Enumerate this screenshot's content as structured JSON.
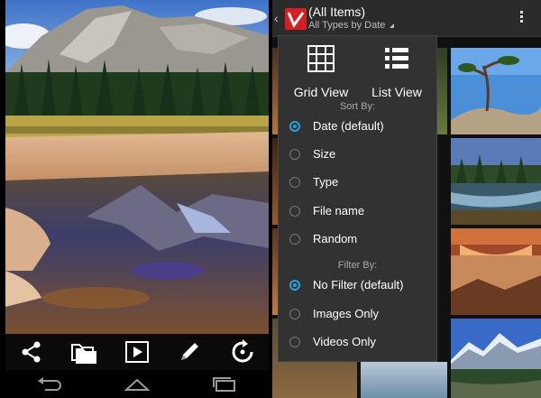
{
  "left_phone": {
    "toolbar": [
      {
        "icon": "share-icon"
      },
      {
        "icon": "folder-move-icon"
      },
      {
        "icon": "slideshow-play-icon"
      },
      {
        "icon": "edit-pencil-icon"
      },
      {
        "icon": "rotate-icon"
      }
    ],
    "nav": [
      "back-icon",
      "home-icon",
      "recents-icon"
    ]
  },
  "right_phone": {
    "header": {
      "title": "(All Items)",
      "subtitle": "All Types by Date",
      "logo_color": "#d81e23"
    },
    "menu": {
      "views": [
        {
          "label": "Grid View",
          "icon": "grid-view-icon"
        },
        {
          "label": "List View",
          "icon": "list-view-icon"
        }
      ],
      "sort_header": "Sort By:",
      "sort_options": [
        {
          "label": "Date (default)",
          "selected": true
        },
        {
          "label": "Size",
          "selected": false
        },
        {
          "label": "Type",
          "selected": false
        },
        {
          "label": "File name",
          "selected": false
        },
        {
          "label": "Random",
          "selected": false
        }
      ],
      "filter_header": "Filter By:",
      "filter_options": [
        {
          "label": "No Filter (default)",
          "selected": true
        },
        {
          "label": "Images Only",
          "selected": false
        },
        {
          "label": "Videos Only",
          "selected": false
        }
      ]
    }
  },
  "colors": {
    "accent": "#2b9fe0",
    "menu_bg": "#323232",
    "action_bar_bg": "#2b2b2b"
  }
}
